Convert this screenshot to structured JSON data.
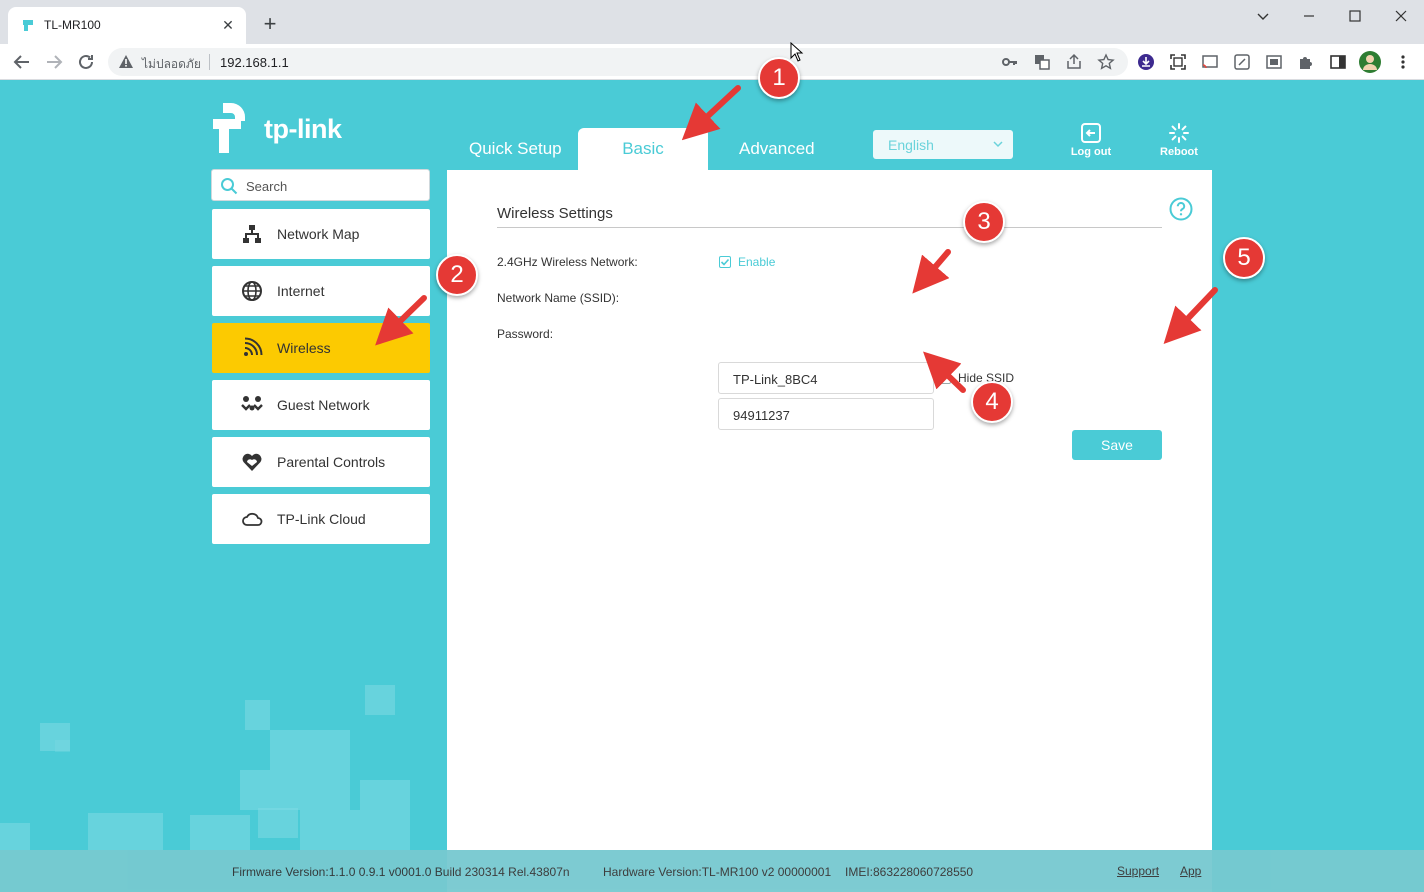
{
  "browser": {
    "tab_title": "TL-MR100",
    "insecure_label": "ไม่ปลอดภัย",
    "url": "192.168.1.1",
    "new_tab_symbol": "+",
    "close_tab_symbol": "✕"
  },
  "brand": {
    "logo_text": "tp-link",
    "accent_color": "#4acbd6",
    "active_color": "#fcca01"
  },
  "top_nav": {
    "quick_setup": "Quick Setup",
    "basic": "Basic",
    "advanced": "Advanced",
    "language": "English",
    "logout": "Log out",
    "reboot": "Reboot"
  },
  "sidebar": {
    "search_placeholder": "Search",
    "items": [
      {
        "label": "Network Map",
        "icon": "network-map-icon"
      },
      {
        "label": "Internet",
        "icon": "globe-icon"
      },
      {
        "label": "Wireless",
        "icon": "wireless-icon",
        "active": true
      },
      {
        "label": "Guest Network",
        "icon": "guest-network-icon"
      },
      {
        "label": "Parental Controls",
        "icon": "parental-controls-icon"
      },
      {
        "label": "TP-Link Cloud",
        "icon": "cloud-icon"
      }
    ]
  },
  "wireless": {
    "title": "Wireless Settings",
    "band_label": "2.4GHz Wireless Network:",
    "enable_label": "Enable",
    "enable_checked": true,
    "ssid_label": "Network Name (SSID):",
    "ssid_value": "TP-Link_8BC4",
    "hide_ssid_label": "Hide SSID",
    "hide_ssid_checked": false,
    "password_label": "Password:",
    "password_value": "94911237",
    "save_label": "Save"
  },
  "footer": {
    "firmware": "Firmware Version:1.1.0 0.9.1 v0001.0 Build 230314 Rel.43807n",
    "hardware": "Hardware Version:TL-MR100 v2 00000001",
    "imei": "IMEI:863228060728550",
    "support": "Support",
    "app": "App"
  },
  "annotations": [
    "1",
    "2",
    "3",
    "4",
    "5"
  ]
}
